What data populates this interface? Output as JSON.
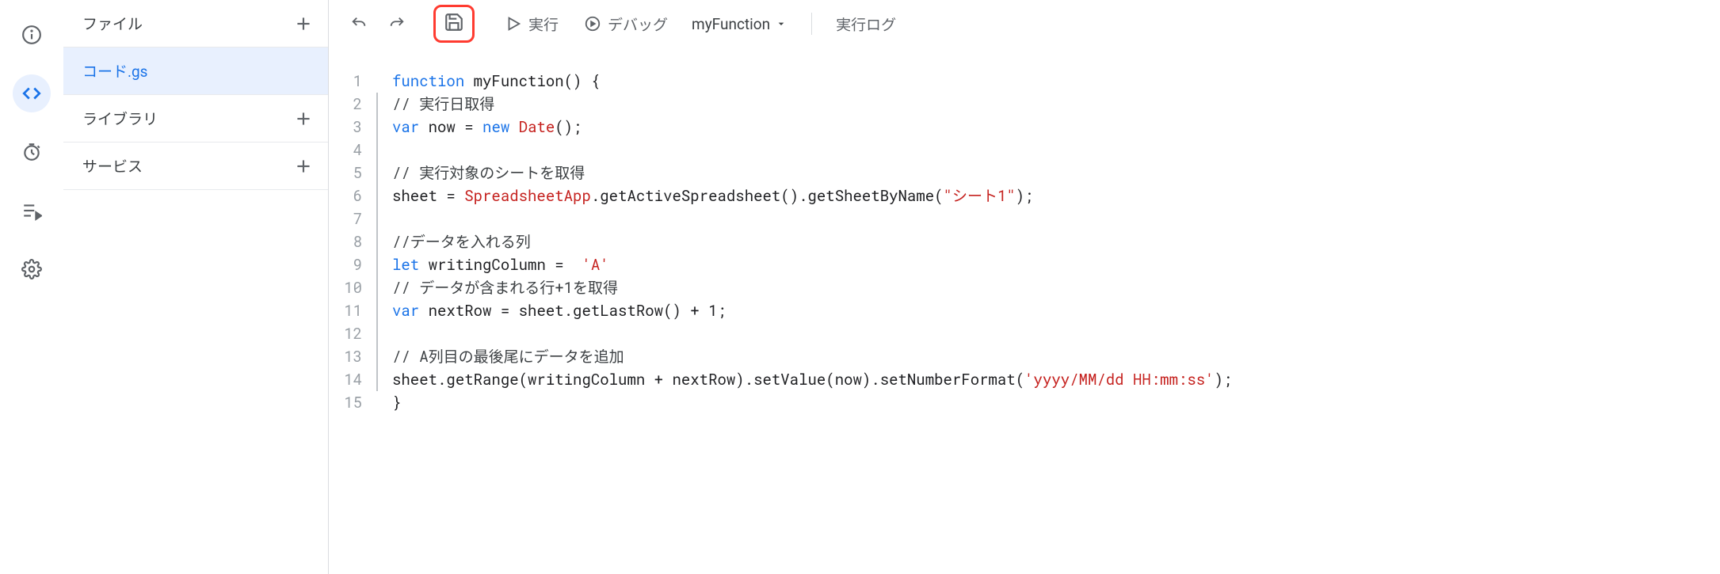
{
  "leftRail": {
    "icons": [
      "info-icon",
      "code-icon",
      "clock-icon",
      "playlist-icon",
      "gear-icon"
    ],
    "activeIndex": 1
  },
  "filePanel": {
    "sections": [
      {
        "label": "ファイル",
        "hasAdd": true
      },
      {
        "label": "コード.gs",
        "selected": true
      },
      {
        "label": "ライブラリ",
        "hasAdd": true
      },
      {
        "label": "サービス",
        "hasAdd": true
      }
    ]
  },
  "toolbar": {
    "undo": "undo-icon",
    "redo": "redo-icon",
    "save": "save-icon",
    "run": "実行",
    "debug": "デバッグ",
    "function": "myFunction",
    "log": "実行ログ"
  },
  "code": {
    "lines": [
      {
        "n": 1,
        "bar": false,
        "tokens": [
          [
            "kw",
            "function"
          ],
          [
            " "
          ],
          [
            "id",
            "myFunction"
          ],
          [
            "",
            "() {"
          ]
        ]
      },
      {
        "n": 2,
        "bar": true,
        "tokens": [
          [
            "cm",
            "// 実行日取得"
          ]
        ]
      },
      {
        "n": 3,
        "bar": true,
        "tokens": [
          [
            "var",
            "var"
          ],
          [
            " now = "
          ],
          [
            "new",
            "new"
          ],
          [
            " "
          ],
          [
            "type",
            "Date"
          ],
          [
            "",
            "();"
          ]
        ]
      },
      {
        "n": 4,
        "bar": true,
        "tokens": [
          [
            "",
            ""
          ]
        ]
      },
      {
        "n": 5,
        "bar": true,
        "tokens": [
          [
            "cm",
            "// 実行対象のシートを取得"
          ]
        ]
      },
      {
        "n": 6,
        "bar": true,
        "tokens": [
          [
            "id",
            "sheet = "
          ],
          [
            "type",
            "SpreadsheetApp"
          ],
          [
            "",
            ".getActiveSpreadsheet().getSheetByName("
          ],
          [
            "str",
            "\"シート1\""
          ],
          [
            "",
            ");"
          ]
        ]
      },
      {
        "n": 7,
        "bar": true,
        "tokens": [
          [
            "",
            ""
          ]
        ]
      },
      {
        "n": 8,
        "bar": true,
        "tokens": [
          [
            "cm",
            "//データを入れる列"
          ]
        ]
      },
      {
        "n": 9,
        "bar": true,
        "tokens": [
          [
            "var",
            "let"
          ],
          [
            " writingColumn =  "
          ],
          [
            "str",
            "'A'"
          ]
        ]
      },
      {
        "n": 10,
        "bar": true,
        "tokens": [
          [
            "cm",
            "// データが含まれる行+1を取得"
          ]
        ]
      },
      {
        "n": 11,
        "bar": true,
        "tokens": [
          [
            "var",
            "var"
          ],
          [
            " nextRow = sheet.getLastRow() + 1;"
          ]
        ]
      },
      {
        "n": 12,
        "bar": true,
        "tokens": [
          [
            "",
            ""
          ]
        ]
      },
      {
        "n": 13,
        "bar": true,
        "tokens": [
          [
            "cm",
            "// A列目の最後尾にデータを追加"
          ]
        ]
      },
      {
        "n": 14,
        "bar": true,
        "tokens": [
          [
            "id",
            "sheet.getRange(writingColumn + nextRow).setValue(now).setNumberFormat("
          ],
          [
            "str",
            "'yyyy/MM/dd HH:mm:ss'"
          ],
          [
            "",
            ");"
          ]
        ]
      },
      {
        "n": 15,
        "bar": false,
        "tokens": [
          [
            "",
            "}"
          ]
        ]
      }
    ]
  }
}
